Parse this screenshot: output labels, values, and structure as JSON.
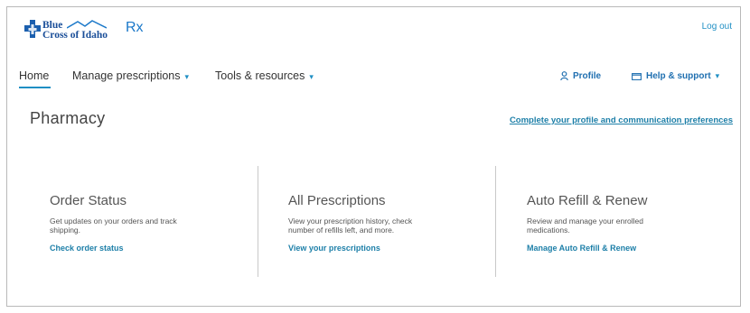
{
  "header": {
    "logo": {
      "line1": "Blue",
      "line2": "Cross of Idaho",
      "rx": "Rx"
    },
    "logout_label": "Log out"
  },
  "nav": {
    "home": "Home",
    "manage_prescriptions": "Manage prescriptions",
    "tools_resources": "Tools & resources",
    "profile": "Profile",
    "help_support": "Help & support"
  },
  "main": {
    "page_title": "Pharmacy",
    "complete_profile_link": "Complete your profile and communication preferences",
    "cards": [
      {
        "title": "Order Status",
        "description": "Get updates on your orders and track shipping.",
        "link": "Check order status"
      },
      {
        "title": "All Prescriptions",
        "description": "View your prescription history, check number of refills left, and more.",
        "link": "View your prescriptions"
      },
      {
        "title": "Auto Refill & Renew",
        "description": "Review and manage your enrolled medications.",
        "link": "Manage Auto Refill & Renew"
      }
    ]
  },
  "colors": {
    "brand_blue": "#1b4f99",
    "link": "#1d7fa8",
    "accent": "#1f8fc4"
  }
}
